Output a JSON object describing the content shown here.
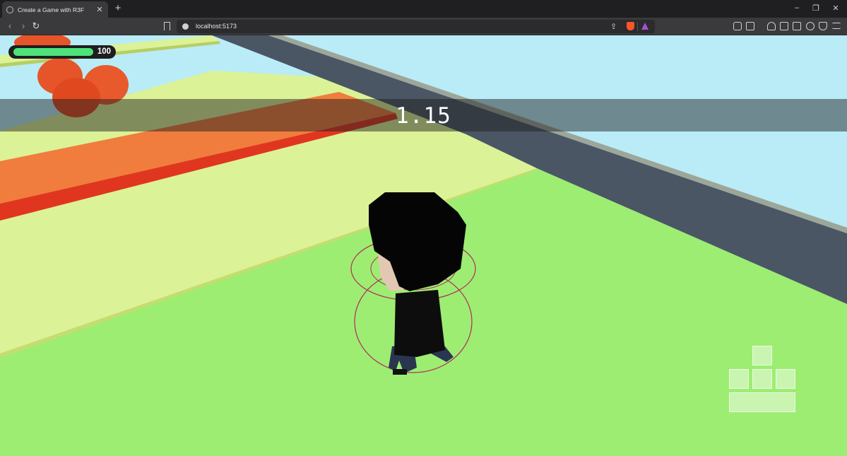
{
  "browser": {
    "tab_title": "Create a Game with R3F",
    "tab_close": "✕",
    "new_tab": "+",
    "url": "localhost:5173",
    "nav": {
      "back": "‹",
      "forward": "›",
      "reload": "↻"
    },
    "window": {
      "minimize": "–",
      "maximize": "❐",
      "close": "✕"
    }
  },
  "game": {
    "health": {
      "value": 100,
      "fraction": 1.0,
      "color": "#4de27a"
    },
    "timer": "1.15",
    "controls": {
      "forward_active": false,
      "left_active": false,
      "backward_active": false,
      "right_active": false,
      "jump_active": false
    },
    "colors": {
      "sky": "#b9ecf7",
      "ground": "#9ded72",
      "platform": "#dcf297",
      "obstacle": "#f07d3d",
      "wall": "#4a5664",
      "balls": "#e6542a"
    }
  }
}
